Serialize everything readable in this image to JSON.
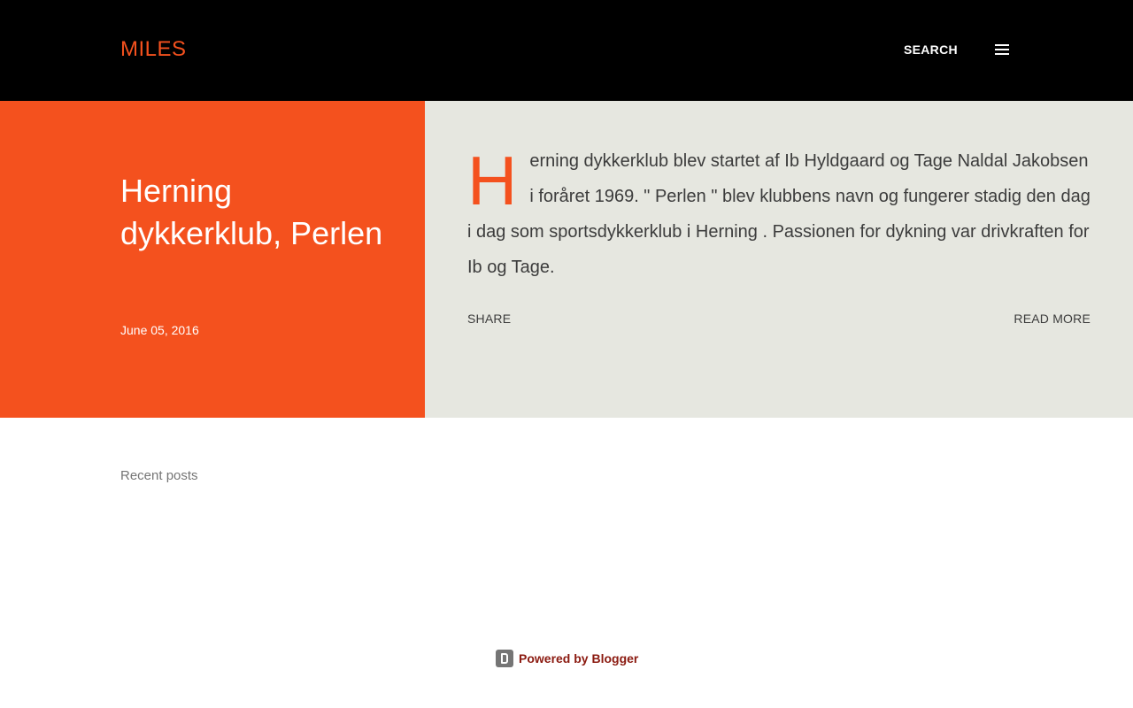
{
  "header": {
    "blog_title": "MILES",
    "search_label": "SEARCH"
  },
  "post": {
    "title": "Herning dykkerklub, Perlen",
    "date": "June 05, 2016",
    "dropcap": "H",
    "snippet_rest": "erning dykkerklub blev startet af Ib Hyldgaard og Tage Naldal Jakobsen i foråret 1969. \" Perlen \" blev klubbens navn og fungerer stadig den dag i dag som sportsdykkerklub i Herning . Passionen for dykning var drivkraften for Ib og Tage.",
    "share_label": "SHARE",
    "read_more_label": "READ MORE"
  },
  "sidebar": {
    "recent_posts_heading": "Recent posts"
  },
  "footer": {
    "powered_by": "Powered by Blogger"
  },
  "colors": {
    "accent": "#f4511e",
    "header_bg": "#000000",
    "snippet_bg": "#e6e7e0",
    "footer_link": "#8b1a10"
  }
}
